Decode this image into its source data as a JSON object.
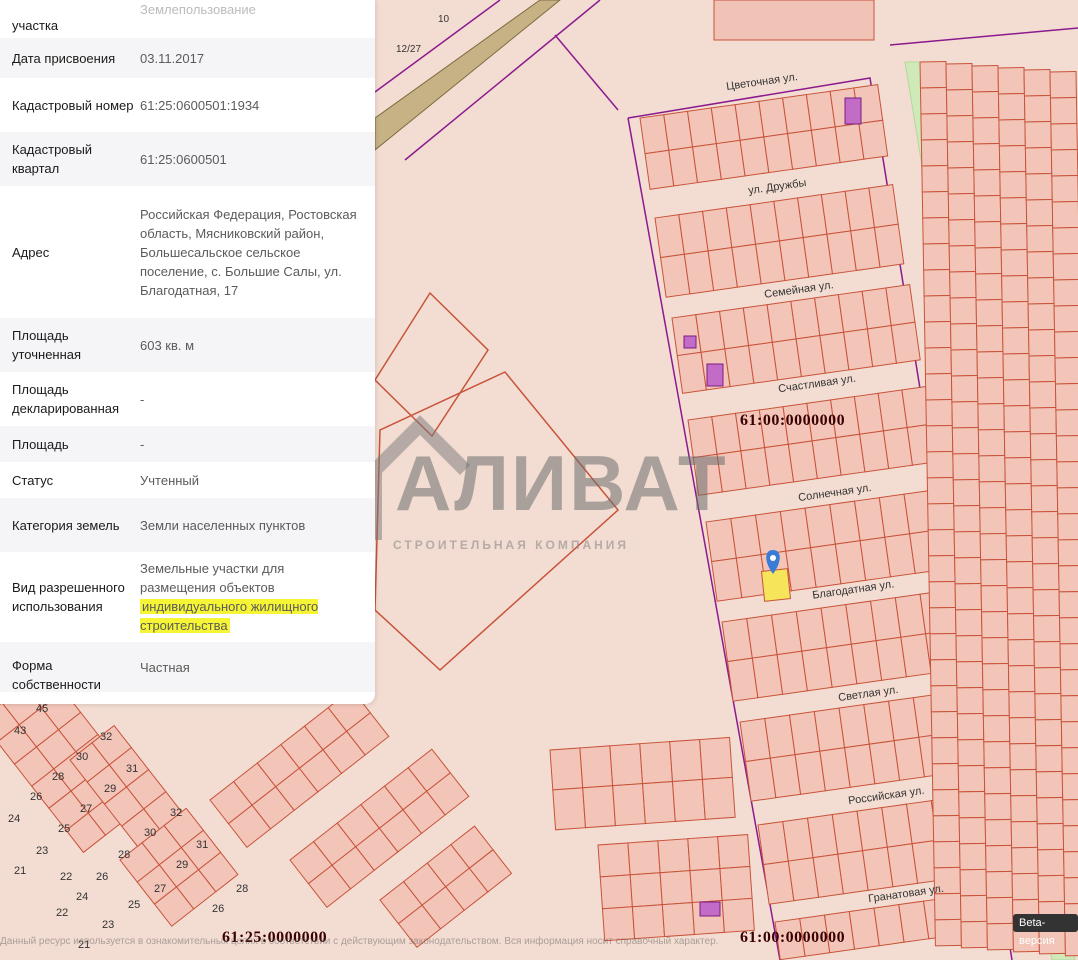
{
  "panel": {
    "rows": [
      {
        "label": "участка",
        "value": "Землепользование"
      },
      {
        "label": "Дата присвоения",
        "value": "03.11.2017"
      },
      {
        "label": "Кадастровый номер",
        "value": "61:25:0600501:1934"
      },
      {
        "label": "Кадастровый квартал",
        "value": "61:25:0600501"
      },
      {
        "label": "Адрес",
        "value": "Российская Федерация, Ростовская область, Мясниковский район, Большесальское сельское поселение, с. Большие Салы, ул. Благодатная, 17"
      },
      {
        "label": "Площадь уточненная",
        "value": "603 кв. м"
      },
      {
        "label": "Площадь декларированная",
        "value": "-"
      },
      {
        "label": "Площадь",
        "value": "-"
      },
      {
        "label": "Статус",
        "value": "Учтенный"
      },
      {
        "label": "Категория земель",
        "value": "Земли населенных пунктов"
      },
      {
        "label": "Вид разрешенного использования",
        "value_plain": "Земельные участки для размещения объектов",
        "value_highlight": "индивидуального жилищного строительства"
      },
      {
        "label": "Форма собственности",
        "value": "Частная"
      }
    ]
  },
  "map": {
    "streets": [
      "Цветочная ул.",
      "ул. Дружбы",
      "Семейная ул.",
      "Счастливая ул.",
      "Солнечная ул.",
      "Благодатная ул.",
      "Светлая ул.",
      "Российская ул.",
      "Гранатовая ул."
    ],
    "cadastral_labels": {
      "right_top": "61:00:0000000",
      "bottom_left": "61:25:0000000",
      "bottom_right": "61:00:0000000"
    },
    "top_labels": {
      "a": "12/27",
      "b": "10"
    },
    "left_lot_numbers": [
      "45",
      "43",
      "32",
      "30",
      "31",
      "28",
      "29",
      "26",
      "27",
      "24",
      "25",
      "23",
      "21",
      "22",
      "30",
      "32",
      "28",
      "31",
      "26",
      "29",
      "24",
      "27",
      "25",
      "28",
      "23",
      "26",
      "22",
      "21"
    ],
    "colors": {
      "lot_stroke": "#c8533a",
      "boundary": "#8b1a8f",
      "background": "#f3ddd2",
      "selected_lot": "#f6e45a",
      "pin": "#3a7bd5",
      "green_strip": "#cfe9b8"
    }
  },
  "watermark": {
    "brand": "АЛИВАТ",
    "tagline": "СТРОИТЕЛЬНАЯ КОМПАНИЯ"
  },
  "badge": {
    "beta": "Beta-версия"
  },
  "footer": {
    "text": "Данный ресурс используется в ознакомительных целях в соответствии с действующим законодательством. Вся информация носит справочный характер."
  }
}
